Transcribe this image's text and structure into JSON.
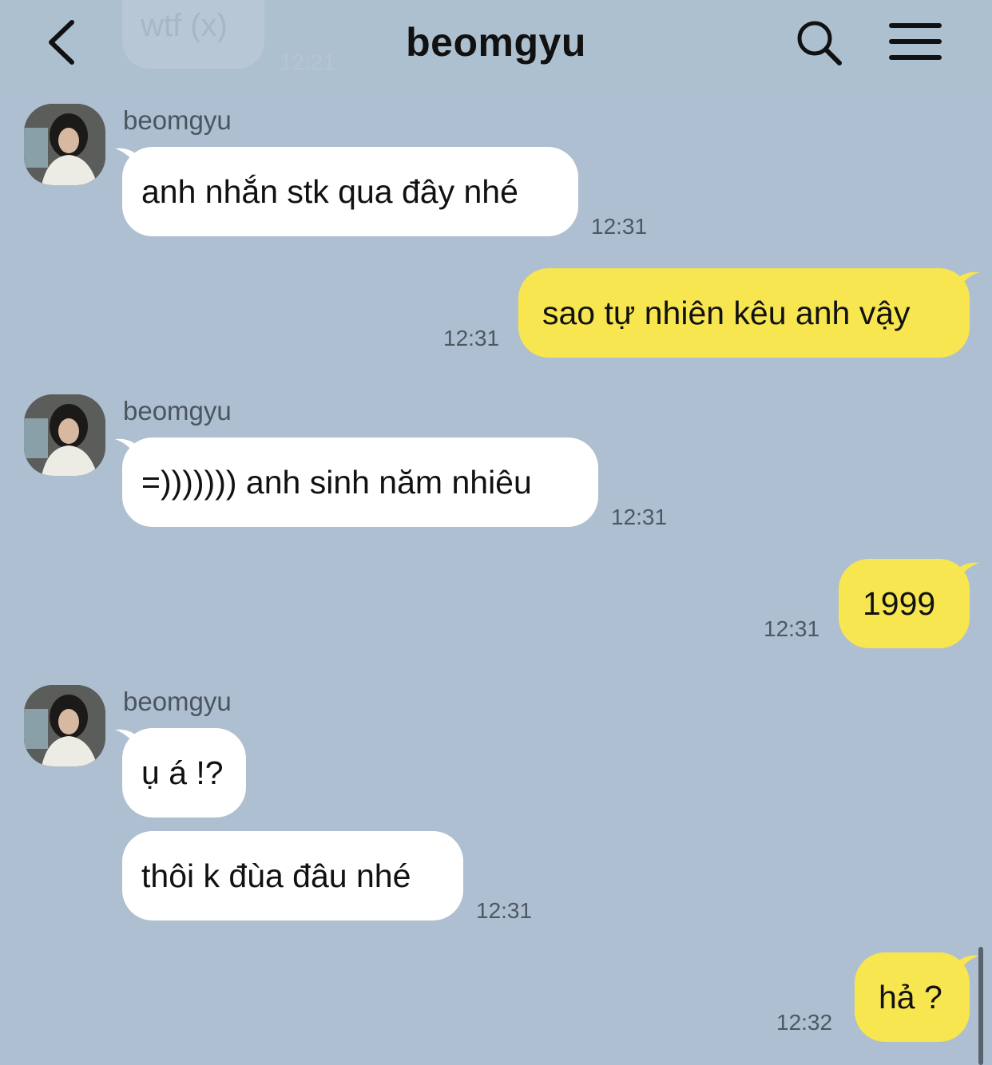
{
  "header": {
    "title": "beomgyu"
  },
  "ghost": {
    "text": "wtf (x)",
    "time": "12:21"
  },
  "messages": [
    {
      "dir": "in",
      "sender": "beomgyu",
      "text": "anh nhắn stk qua đây nhé",
      "time": "12:31"
    },
    {
      "dir": "out",
      "text": "sao tự nhiên kêu anh vậy",
      "time": "12:31"
    },
    {
      "dir": "in",
      "sender": "beomgyu",
      "text": "=))))))) anh sinh năm nhiêu",
      "time": "12:31"
    },
    {
      "dir": "out",
      "text": "1999",
      "time": "12:31"
    },
    {
      "dir": "in",
      "sender": "beomgyu",
      "text": "ụ á !?"
    },
    {
      "dir": "in",
      "text": "thôi k đùa đâu nhé",
      "time": "12:31"
    },
    {
      "dir": "out",
      "text": "hả ?",
      "time": "12:32"
    }
  ],
  "colors": {
    "background": "#adbfd0",
    "incoming": "#ffffff",
    "outgoing": "#f7e650"
  }
}
